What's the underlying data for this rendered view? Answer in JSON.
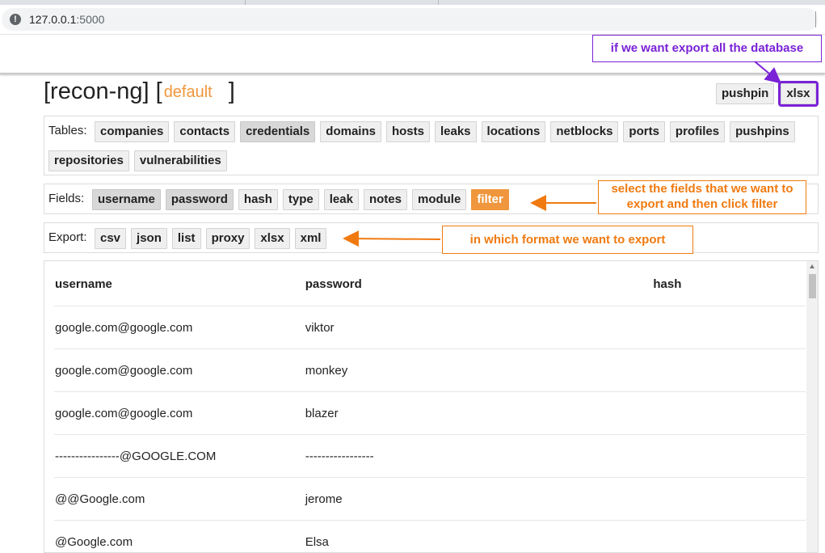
{
  "browser": {
    "url_host": "127.0.0.1",
    "url_port": ":5000"
  },
  "header": {
    "title_prefix": "[recon-ng] [",
    "workspace": "default",
    "title_suffix": "]",
    "actions": [
      "pushpin",
      "xlsx"
    ]
  },
  "tables": {
    "label": "Tables:",
    "items": [
      "companies",
      "contacts",
      "credentials",
      "domains",
      "hosts",
      "leaks",
      "locations",
      "netblocks",
      "ports",
      "profiles",
      "pushpins",
      "repositories",
      "vulnerabilities"
    ],
    "active": "credentials"
  },
  "fields": {
    "label": "Fields:",
    "items": [
      "username",
      "password",
      "hash",
      "type",
      "leak",
      "notes",
      "module"
    ],
    "selected": [
      "username",
      "password"
    ],
    "filter_label": "filter"
  },
  "export": {
    "label": "Export:",
    "items": [
      "csv",
      "json",
      "list",
      "proxy",
      "xlsx",
      "xml"
    ]
  },
  "annotations": {
    "export_all": "if we want export all the database",
    "select_fields": "select the fields that we want to export and then click filter",
    "format": "in which format we want to export"
  },
  "results": {
    "columns": [
      "username",
      "password",
      "hash"
    ],
    "rows": [
      [
        "google.com@google.com",
        "viktor",
        ""
      ],
      [
        "google.com@google.com",
        "monkey",
        ""
      ],
      [
        "google.com@google.com",
        "blazer",
        ""
      ],
      [
        "----------------@GOOGLE.COM",
        "-----------------",
        ""
      ],
      [
        "@@Google.com",
        "jerome",
        ""
      ],
      [
        "@Google.com",
        "Elsa",
        ""
      ]
    ]
  },
  "colors": {
    "accent_orange": "#f0963c",
    "annotation_purple": "#7a22d6",
    "annotation_orange": "#f07a10"
  }
}
